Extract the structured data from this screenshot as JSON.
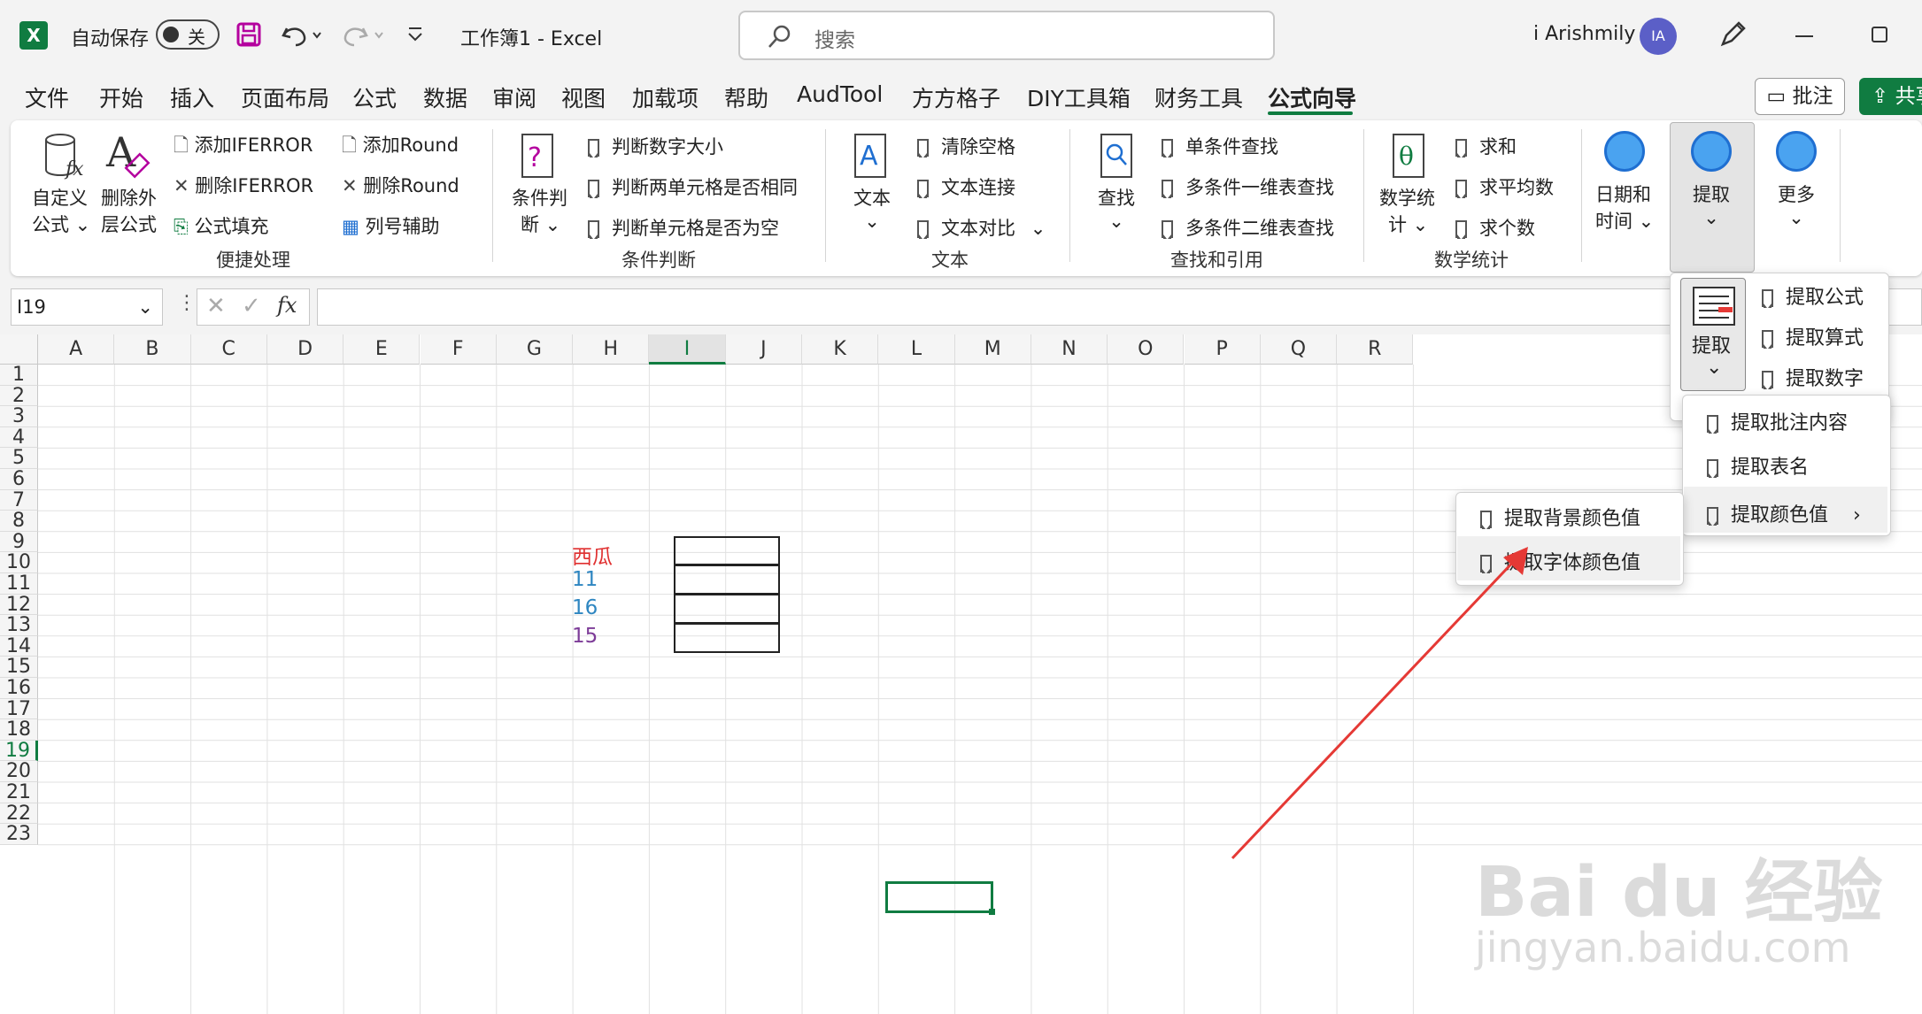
{
  "titlebar": {
    "autosave_label": "自动保存",
    "autosave_state": "关",
    "file_title": "工作簿1  -  Excel",
    "search_placeholder": "搜索",
    "user_name": "i Arishmily",
    "avatar_initials": "IA"
  },
  "menu": {
    "tabs": [
      "文件",
      "开始",
      "插入",
      "页面布局",
      "公式",
      "数据",
      "审阅",
      "视图",
      "加载项",
      "帮助",
      "AudTool",
      "方方格子",
      "DIY工具箱",
      "财务工具",
      "公式向导"
    ],
    "active_tab": "公式向导",
    "comments_button": "批注",
    "share_button": "共享"
  },
  "ribbon": {
    "quick": {
      "custom_formula": "自定义公式",
      "custom_formula_l1": "自定义",
      "custom_formula_l2": "公式",
      "delete_outer_l1": "删除外",
      "delete_outer_l2": "层公式",
      "add_iferror": "添加IFERROR",
      "delete_iferror": "删除IFERROR",
      "formula_fill": "公式填充",
      "add_round": "添加Round",
      "delete_round": "删除Round",
      "column_helper": "列号辅助",
      "group_label": "便捷处理"
    },
    "condition": {
      "cond_l1": "条件判",
      "cond_l2": "断",
      "judge_number_size": "判断数字大小",
      "judge_two_same": "判断两单元格是否相同",
      "judge_empty": "判断单元格是否为空",
      "group_label": "条件判断"
    },
    "text": {
      "text_button": "文本",
      "clear_spaces": "清除空格",
      "text_join": "文本连接",
      "text_compare": "文本对比",
      "group_label": "文本"
    },
    "lookup": {
      "find_button": "查找",
      "single_lookup": "单条件查找",
      "multi_1d": "多条件一维表查找",
      "multi_2d": "多条件二维表查找",
      "group_label": "查找和引用"
    },
    "math": {
      "math_l1": "数学统",
      "math_l2": "计",
      "sum": "求和",
      "average": "求平均数",
      "count": "求个数",
      "group_label": "数学统计"
    },
    "extra": {
      "datetime_l1": "日期和",
      "datetime_l2": "时间",
      "extract": "提取",
      "more": "更多"
    }
  },
  "formula_bar": {
    "name_box": "I19",
    "fx_label": "fx",
    "content": ""
  },
  "sheet": {
    "columns": [
      "A",
      "B",
      "C",
      "D",
      "E",
      "F",
      "G",
      "H",
      "I",
      "J",
      "K",
      "L",
      "M",
      "N",
      "O",
      "P",
      "Q",
      "R"
    ],
    "rows": [
      "1",
      "2",
      "3",
      "4",
      "5",
      "6",
      "7",
      "8",
      "9",
      "10",
      "11",
      "12",
      "13",
      "14",
      "15",
      "16",
      "17",
      "18",
      "19",
      "20",
      "21",
      "22",
      "23"
    ],
    "selected_cell": "I19",
    "cells": {
      "F7": "西瓜",
      "F8": "11",
      "F9": "16",
      "F10": "15"
    },
    "cell_colors": {
      "F7": "#e03030",
      "F8": "#2e86c1",
      "F9": "#2e86c1",
      "F10": "#7d3c98"
    }
  },
  "extract_menu": {
    "big_button": "提取",
    "items": [
      "提取公式",
      "提取算式",
      "提取数字"
    ],
    "sub_items": [
      "提取批注内容",
      "提取表名",
      "提取颜色值"
    ],
    "color_submenu": [
      "提取背景颜色值",
      "提取字体颜色值"
    ]
  },
  "watermark": {
    "logo": "Bai du 经验",
    "url": "jingyan.baidu.com"
  },
  "colors": {
    "excel_green": "#107c41",
    "arrow_red": "#e53935",
    "accent_blue": "#4aa3f0"
  }
}
